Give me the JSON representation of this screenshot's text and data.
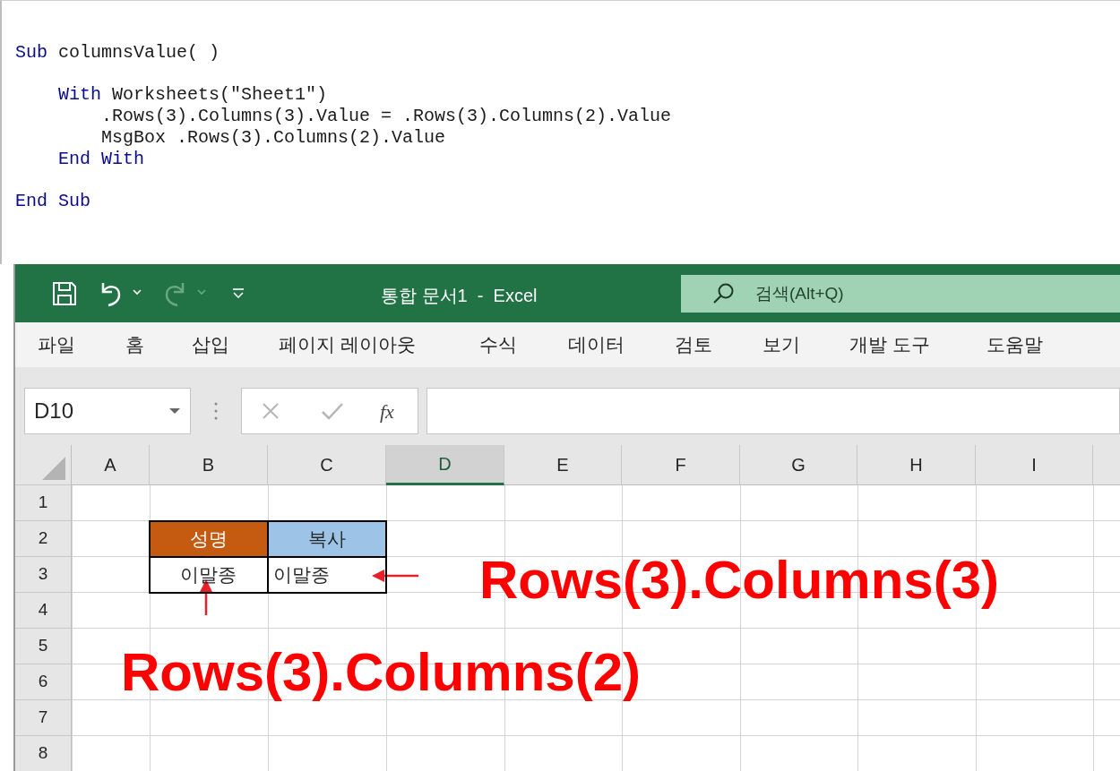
{
  "code": {
    "blocks": [
      [
        [
          {
            "text": "Sub",
            "kind": "keyword"
          },
          {
            "text": " columnsValue( )",
            "kind": "plain"
          }
        ]
      ],
      [
        [
          {
            "text": "    With",
            "kind": "keyword"
          },
          {
            "text": " Worksheets(\"Sheet1\")",
            "kind": "plain"
          }
        ],
        [
          {
            "text": "        .Rows(3).Columns(3).Value = .Rows(3).Columns(2).Value",
            "kind": "plain"
          }
        ],
        [
          {
            "text": "        MsgBox .Rows(3).Columns(2).Value",
            "kind": "plain"
          }
        ],
        [
          {
            "text": "    End With",
            "kind": "keyword"
          }
        ]
      ],
      [
        [
          {
            "text": "End Sub",
            "kind": "keyword"
          }
        ]
      ]
    ]
  },
  "excel": {
    "title": "통합 문서1  -  Excel",
    "search": {
      "placeholder": "검색(Alt+Q)"
    },
    "ribbon_tabs": [
      {
        "label": "파일",
        "selected": false
      },
      {
        "label": "홈",
        "selected": false
      },
      {
        "label": "삽입",
        "selected": false
      },
      {
        "label": "페이지 레이아웃",
        "selected": false
      },
      {
        "label": "수식",
        "selected": false
      },
      {
        "label": "데이터",
        "selected": false
      },
      {
        "label": "검토",
        "selected": false
      },
      {
        "label": "보기",
        "selected": false
      },
      {
        "label": "개발 도구",
        "selected": false
      },
      {
        "label": "도움말",
        "selected": false
      }
    ],
    "name_box": "D10",
    "function_button": "fx",
    "columns": [
      {
        "label": "A",
        "selected": false
      },
      {
        "label": "B",
        "selected": false
      },
      {
        "label": "C",
        "selected": false
      },
      {
        "label": "D",
        "selected": true
      },
      {
        "label": "E",
        "selected": false
      },
      {
        "label": "F",
        "selected": false
      },
      {
        "label": "G",
        "selected": false
      },
      {
        "label": "H",
        "selected": false
      },
      {
        "label": "I",
        "selected": false
      }
    ],
    "rows": [
      {
        "label": "1",
        "cells": {}
      },
      {
        "label": "2",
        "cells": {
          "B": {
            "text": "성명",
            "kind": "header",
            "color": "#c55a11"
          },
          "C": {
            "text": "복사",
            "kind": "header",
            "color": "#9dc3e6"
          }
        }
      },
      {
        "label": "3",
        "cells": {
          "B": {
            "text": "이말종",
            "kind": "value"
          },
          "C": {
            "text": "이말종",
            "kind": "copy"
          }
        }
      },
      {
        "label": "4",
        "cells": {}
      },
      {
        "label": "5",
        "cells": {}
      },
      {
        "label": "6",
        "cells": {}
      },
      {
        "label": "7",
        "cells": {}
      },
      {
        "label": "8",
        "cells": {}
      }
    ],
    "annotations": [
      {
        "text": "Rows(3).Columns(3)"
      },
      {
        "text": "Rows(3).Columns(2)"
      }
    ]
  }
}
